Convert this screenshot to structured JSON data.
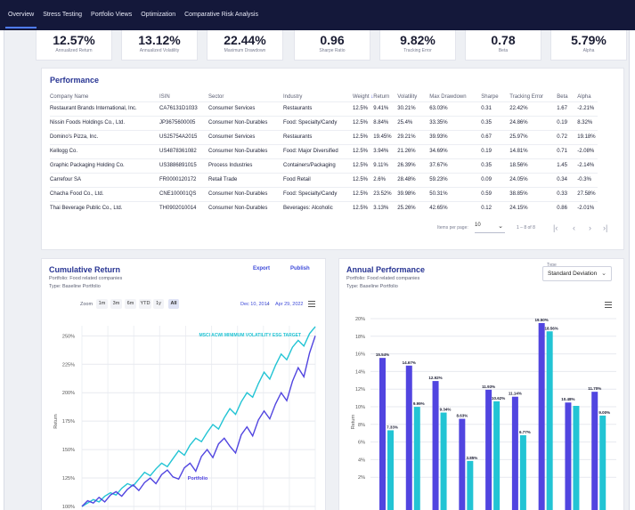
{
  "nav": {
    "tabs": [
      "Overview",
      "Stress Testing",
      "Portfolio Views",
      "Optimization",
      "Comparative Risk Analysis"
    ],
    "active": 0
  },
  "metrics": [
    {
      "value": "12.57%",
      "label": "Annualized Return"
    },
    {
      "value": "13.12%",
      "label": "Annualized Volatility"
    },
    {
      "value": "22.44%",
      "label": "Maximum Drawdown"
    },
    {
      "value": "0.96",
      "label": "Sharpe Ratio"
    },
    {
      "value": "9.82%",
      "label": "Tracking Error"
    },
    {
      "value": "0.78",
      "label": "Beta"
    },
    {
      "value": "5.79%",
      "label": "Alpha"
    }
  ],
  "performance": {
    "title": "Performance",
    "columns": [
      "Company Name",
      "ISIN",
      "Sector",
      "Industry",
      "Weight",
      "Return",
      "Volatility",
      "Max Drawdown",
      "Sharpe",
      "Tracking Error",
      "Beta",
      "Alpha"
    ],
    "sort_arrow": "↓",
    "rows": [
      [
        "Restaurant Brands International, Inc.",
        "CA76131D1033",
        "Consumer Services",
        "Restaurants",
        "12.5%",
        "9.41%",
        "30.21%",
        "63.03%",
        "0.31",
        "22.42%",
        "1.67",
        "-2.21%"
      ],
      [
        "Nissin Foods Holdings Co., Ltd.",
        "JP3675600005",
        "Consumer Non-Durables",
        "Food: Specialty/Candy",
        "12.5%",
        "8.84%",
        "25.4%",
        "33.35%",
        "0.35",
        "24.86%",
        "0.19",
        "8.32%"
      ],
      [
        "Domino's Pizza, Inc.",
        "US25754A2015",
        "Consumer Services",
        "Restaurants",
        "12.5%",
        "19.45%",
        "29.21%",
        "39.93%",
        "0.67",
        "25.97%",
        "0.72",
        "19.18%"
      ],
      [
        "Kellogg Co.",
        "US4878361082",
        "Consumer Non-Durables",
        "Food: Major Diversified",
        "12.5%",
        "3.94%",
        "21.26%",
        "34.69%",
        "0.19",
        "14.81%",
        "0.71",
        "-2.08%"
      ],
      [
        "Graphic Packaging Holding Co.",
        "US3886891015",
        "Process Industries",
        "Containers/Packaging",
        "12.5%",
        "9.11%",
        "26.39%",
        "37.67%",
        "0.35",
        "18.56%",
        "1.45",
        "-2.14%"
      ],
      [
        "Carrefour SA",
        "FR0000120172",
        "Retail Trade",
        "Food Retail",
        "12.5%",
        "2.6%",
        "28.48%",
        "59.23%",
        "0.09",
        "24.05%",
        "0.34",
        "-0.3%"
      ],
      [
        "Chacha Food Co., Ltd.",
        "CNE100001QS",
        "Consumer Non-Durables",
        "Food: Specialty/Candy",
        "12.5%",
        "23.52%",
        "39.98%",
        "50.31%",
        "0.59",
        "38.85%",
        "0.33",
        "27.58%"
      ],
      [
        "Thai Beverage Public Co., Ltd.",
        "TH0902010014",
        "Consumer Non-Durables",
        "Beverages: Alcoholic",
        "12.5%",
        "3.13%",
        "25.26%",
        "42.65%",
        "0.12",
        "24.15%",
        "0.86",
        "-2.01%"
      ]
    ],
    "pager": {
      "items_label": "Items per page:",
      "items_value": "10",
      "range": "1 – 8 of 8"
    }
  },
  "cumulative": {
    "title": "Cumulative Return",
    "portfolio": "Portfolio: Food related companies",
    "type": "Type: Baseline Portfolio",
    "export": "Export",
    "publish": "Publish",
    "zoom_label": "Zoom",
    "zoom_options": [
      "1m",
      "3m",
      "6m",
      "YTD",
      "1y",
      "All"
    ],
    "range_from": "Dec 10, 2014",
    "range_sep": "→",
    "range_to": "Apr 29, 2022"
  },
  "annual": {
    "title": "Annual Performance",
    "portfolio": "Portfolio: Food related companies",
    "type": "Type: Baseline Portfolio",
    "select_label": "Type",
    "select_value": "Standard Deviation"
  },
  "chart_data": [
    {
      "type": "line",
      "ylabel": "Return",
      "y_ticks": [
        "100%",
        "125%",
        "150%",
        "175%",
        "200%",
        "225%",
        "250%"
      ],
      "ylim": [
        100,
        262
      ],
      "series": [
        {
          "name": "MSCI ACWI MINIMUM VOLATILITY ESG TARGET",
          "color": "#22c4d4",
          "values": [
            100,
            103,
            106,
            104,
            109,
            112,
            110,
            116,
            120,
            118,
            124,
            130,
            127,
            133,
            138,
            135,
            142,
            149,
            145,
            154,
            160,
            157,
            165,
            172,
            168,
            178,
            186,
            181,
            192,
            200,
            196,
            208,
            218,
            212,
            224,
            234,
            229,
            240,
            246,
            241,
            252,
            258
          ]
        },
        {
          "name": "Portfolio",
          "color": "#5145e0",
          "values": [
            100,
            105,
            103,
            108,
            104,
            110,
            113,
            109,
            115,
            119,
            114,
            121,
            125,
            120,
            128,
            132,
            126,
            124,
            134,
            138,
            131,
            144,
            150,
            143,
            155,
            160,
            153,
            147,
            163,
            170,
            162,
            176,
            184,
            177,
            190,
            200,
            193,
            210,
            222,
            214,
            235,
            250
          ]
        }
      ]
    },
    {
      "type": "bar",
      "ylabel": "Return",
      "y_ticks": [
        "2%",
        "4%",
        "6%",
        "8%",
        "10%",
        "12%",
        "14%",
        "16%",
        "18%",
        "20%"
      ],
      "ylim": [
        0,
        20
      ],
      "series": [
        {
          "color": "#5145e0",
          "values": [
            15.54,
            14.67,
            12.92,
            8.63,
            11.93,
            11.14,
            19.5,
            10.48,
            11.7
          ],
          "labels": [
            "15.54%",
            "14.67%",
            "12.92%",
            "8.63%",
            "11.93%",
            "11.14%",
            "19.50%",
            "10.48%",
            "11.70%"
          ]
        },
        {
          "color": "#22c4d4",
          "values": [
            7.33,
            9.99,
            9.34,
            3.85,
            10.62,
            6.77,
            18.56,
            10.1,
            9.0
          ],
          "labels": [
            "7.33%",
            "9.99%",
            "9.34%",
            "3.85%",
            "10.62%",
            "6.77%",
            "18.56%",
            "",
            "9.00%"
          ]
        }
      ]
    }
  ]
}
